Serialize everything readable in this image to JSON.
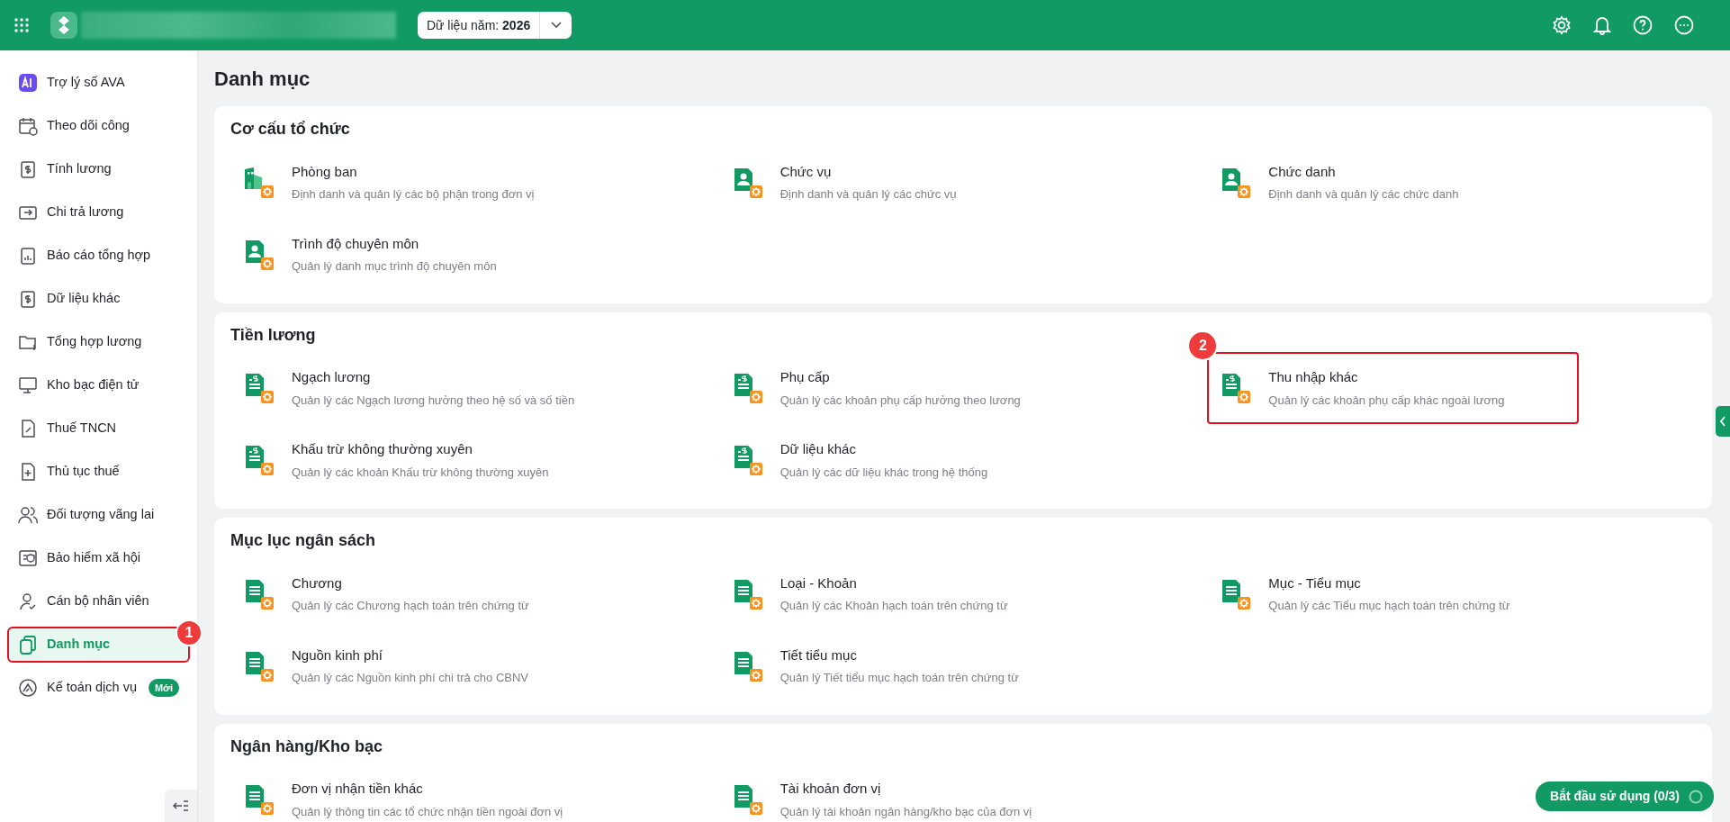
{
  "topbar": {
    "year_label": "Dữ liệu năm:",
    "year": "2026"
  },
  "sidebar": {
    "items": [
      {
        "label": "Trợ lý số AVA",
        "selected": false
      },
      {
        "label": "Theo dõi công",
        "selected": false
      },
      {
        "label": "Tính lương",
        "selected": false
      },
      {
        "label": "Chi trả lương",
        "selected": false
      },
      {
        "label": "Báo cáo tổng hợp",
        "selected": false
      },
      {
        "label": "Dữ liệu khác",
        "selected": false
      },
      {
        "label": "Tổng hợp lương",
        "selected": false
      },
      {
        "label": "Kho bạc điện tử",
        "selected": false
      },
      {
        "label": "Thuế TNCN",
        "selected": false
      },
      {
        "label": "Thủ tục thuế",
        "selected": false
      },
      {
        "label": "Đối tượng vãng lai",
        "selected": false
      },
      {
        "label": "Bảo hiểm xã hội",
        "selected": false
      },
      {
        "label": "Cán bộ nhân viên",
        "selected": false
      },
      {
        "label": "Danh mục",
        "selected": true,
        "callout": "1"
      },
      {
        "label": "Kế toán dịch vụ",
        "selected": false,
        "badge": "Mới"
      }
    ]
  },
  "page_title": "Danh mục",
  "sections": [
    {
      "title": "Cơ cấu tổ chức",
      "items": [
        {
          "title": "Phòng ban",
          "description": "Định danh và quản lý các bộ phận trong đơn vị"
        },
        {
          "title": "Chức vụ",
          "description": "Định danh và quản lý các chức vụ"
        },
        {
          "title": "Chức danh",
          "description": "Định danh và quản lý các chức danh"
        },
        {
          "title": "Trình độ chuyên môn",
          "description": "Quản lý danh mục trình độ chuyên môn"
        }
      ]
    },
    {
      "title": "Tiền lương",
      "items": [
        {
          "title": "Ngạch lương",
          "description": "Quản lý các Ngạch lương hưởng theo hệ số và số tiền"
        },
        {
          "title": "Phụ cấp",
          "description": "Quản lý các khoản phụ cấp hưởng theo lương"
        },
        {
          "title": "Thu nhập khác",
          "description": "Quản lý các khoản phụ cấp khác ngoài lương",
          "callout": "2"
        },
        {
          "title": "Khấu trừ không thường xuyên",
          "description": "Quản lý các khoản Khấu trừ không thường xuyên"
        },
        {
          "title": "Dữ liệu khác",
          "description": "Quản lý các dữ liệu khác trong hệ thống"
        }
      ]
    },
    {
      "title": "Mục lục ngân sách",
      "items": [
        {
          "title": "Chương",
          "description": "Quản lý các Chương hạch toán trên chứng từ"
        },
        {
          "title": "Loại - Khoản",
          "description": "Quản lý các Khoản hạch toán trên chứng từ"
        },
        {
          "title": "Mục - Tiểu mục",
          "description": "Quản lý các Tiểu mục hạch toán trên chứng từ"
        },
        {
          "title": "Nguồn kinh phí",
          "description": "Quản lý các Nguồn kinh phí chi trả cho CBNV"
        },
        {
          "title": "Tiết tiểu mục",
          "description": "Quản lý Tiết tiểu mục hạch toán trên chứng từ"
        }
      ]
    },
    {
      "title": "Ngân hàng/Kho bạc",
      "items": [
        {
          "title": "Đơn vị nhận tiền khác",
          "description": "Quản lý thông tin các tổ chức nhận tiền ngoài đơn vị"
        },
        {
          "title": "Tài khoản đơn vị",
          "description": "Quản lý tài khoản ngân hàng/kho bạc của đơn vị"
        }
      ]
    }
  ],
  "start_button": {
    "label": "Bắt đầu sử dụng (0/3)"
  }
}
